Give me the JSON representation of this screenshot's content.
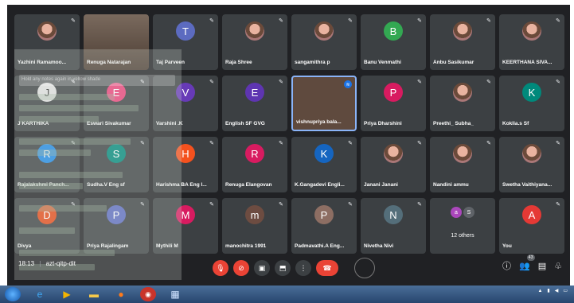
{
  "meeting": {
    "time": "18:13",
    "code": "azt-qitp-dit",
    "participant_count": "43"
  },
  "tiles": [
    {
      "name": "Yazhini Ramamoo...",
      "initial": "",
      "color": "",
      "kind": "photo"
    },
    {
      "name": "Renuga Natarajan",
      "initial": "",
      "color": "",
      "kind": "video"
    },
    {
      "name": "Taj Parveen",
      "initial": "T",
      "color": "#5c6bc0",
      "kind": "letter"
    },
    {
      "name": "Raja Shree",
      "initial": "",
      "color": "",
      "kind": "photo"
    },
    {
      "name": "sangamithra p",
      "initial": "",
      "color": "",
      "kind": "photo"
    },
    {
      "name": "Banu Venmathi",
      "initial": "B",
      "color": "#33a852",
      "kind": "letter"
    },
    {
      "name": "Anbu Sasikumar",
      "initial": "",
      "color": "",
      "kind": "photo"
    },
    {
      "name": "KEERTHANA SIVA...",
      "initial": "",
      "color": "",
      "kind": "photo"
    },
    {
      "name": "J KARTHIKA",
      "initial": "J",
      "color": "#e0e0e0",
      "kind": "letter"
    },
    {
      "name": "Eswari Sivakumar",
      "initial": "E",
      "color": "#ec407a",
      "kind": "letter"
    },
    {
      "name": "Varshini .K",
      "initial": "V",
      "color": "#673ab7",
      "kind": "letter"
    },
    {
      "name": "English SF GVG",
      "initial": "E",
      "color": "#5e35b1",
      "kind": "letter"
    },
    {
      "name": "vishnupriya bala...",
      "initial": "",
      "color": "",
      "kind": "active"
    },
    {
      "name": "Priya Dharshini",
      "initial": "P",
      "color": "#d81b60",
      "kind": "letter"
    },
    {
      "name": "Preethi_ Subha_",
      "initial": "",
      "color": "",
      "kind": "photo"
    },
    {
      "name": "Koklia.s Sf",
      "initial": "K",
      "color": "#00897b",
      "kind": "letter"
    },
    {
      "name": "Rajalakshmi Panch...",
      "initial": "R",
      "color": "#1e88e5",
      "kind": "letter"
    },
    {
      "name": "Sudha.V Eng sf",
      "initial": "S",
      "color": "#00897b",
      "kind": "letter"
    },
    {
      "name": "Harishma BA Eng l...",
      "initial": "H",
      "color": "#f4511e",
      "kind": "letter"
    },
    {
      "name": "Renuga Elangovan",
      "initial": "R",
      "color": "#d81b60",
      "kind": "letter"
    },
    {
      "name": "K.Gangadevi Engli...",
      "initial": "K",
      "color": "#1565c0",
      "kind": "letter"
    },
    {
      "name": "Janani Janani",
      "initial": "",
      "color": "",
      "kind": "photo"
    },
    {
      "name": "Nandini ammu",
      "initial": "",
      "color": "",
      "kind": "photo"
    },
    {
      "name": "Swetha Vaithiyana...",
      "initial": "",
      "color": "",
      "kind": "photo"
    },
    {
      "name": "Divya",
      "initial": "D",
      "color": "#e64a19",
      "kind": "letter"
    },
    {
      "name": "Priya Rajalingam",
      "initial": "P",
      "color": "#5c6bc0",
      "kind": "letter"
    },
    {
      "name": "Mythili M",
      "initial": "M",
      "color": "#d81b60",
      "kind": "letter"
    },
    {
      "name": "manochitra 1991",
      "initial": "m",
      "color": "#6d4c41",
      "kind": "letter"
    },
    {
      "name": "Padmavathi.A Eng...",
      "initial": "P",
      "color": "#8d6e63",
      "kind": "letter"
    },
    {
      "name": "Nivetha Nivi",
      "initial": "N",
      "color": "#546e7a",
      "kind": "letter"
    },
    {
      "name": "",
      "initial": "",
      "color": "",
      "kind": "others"
    },
    {
      "name": "You",
      "initial": "A",
      "color": "#e53935",
      "kind": "letter"
    }
  ],
  "others": {
    "label": "12 others",
    "a": "a",
    "s": "S"
  },
  "overlay": {
    "placeholder": "Hold any notes again in yellow shade"
  },
  "colors": {
    "meet_bg": "#202124",
    "tile_bg": "#3c4043",
    "end_call": "#ea4335",
    "active_border": "#8ab4f8"
  },
  "icons": {
    "mic_off": "mic-off-icon",
    "camera_off": "camera-off-icon",
    "captions": "captions-icon",
    "present": "present-icon",
    "more": "more-icon",
    "hang_up": "hang-up-icon",
    "info": "info-icon",
    "people": "people-icon",
    "chat": "chat-icon",
    "activities": "activities-icon"
  }
}
